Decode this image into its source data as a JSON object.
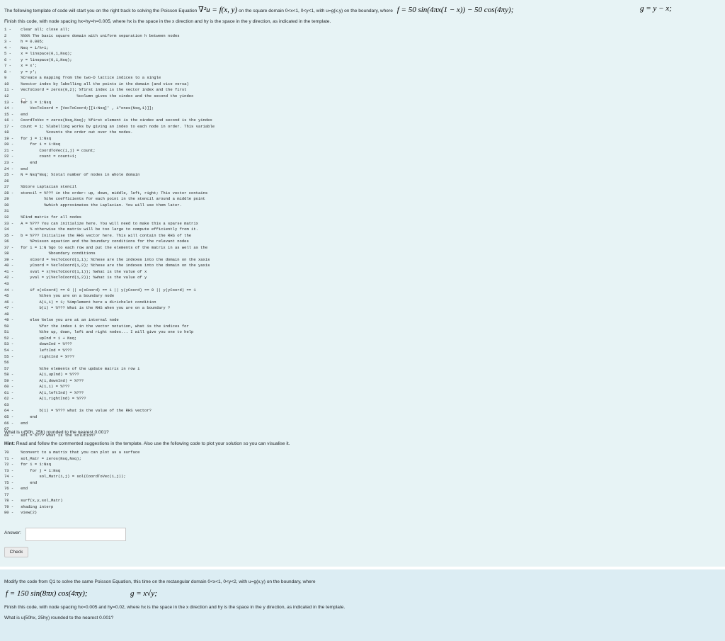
{
  "question1": {
    "intro_before": "The following template of code will start you on the right track to solving the Poisson Equation",
    "intro_eq": "∇²u = f(x, y)",
    "intro_after": "on the square domain 0<x<1, 0<y<1, with u=g(x,y) on the boundary, where",
    "f_eq": "f = 50 sin(4πx(1 − x)) − 50 cos(4πy);",
    "g_eq": "g = y − x;",
    "finish_text": "Finish this code, with node spacing hx=hy=h=0.005, where hx is the space in the x direction and hy is the space in the y direction, as indicated in the template.",
    "code_lines": [
      "1 -    clear all; close all;",
      "2      %%%% The basic square domain with uniform separation h between nodes",
      "3 -    h = 0.005;",
      "4 -    Nsq = 1/h+1;",
      "5 -    x = linspace(0,1,Nsq);",
      "6 -    y = linspace(0,1,Nsq);",
      "7 -    x = x';",
      "8 -    y = y';",
      "9      %Create a mapping from the two-D lattice indices to a single",
      "10     %vector index by labelling all the points in the domain (and vice versa)",
      "11 -   VecToCoord = zeros(0,2); %first index is the vector index and the first",
      "12                             %column gives the xindex and the second the yindex",
      "13 -   for i = 1:Nsq",
      "14 -       VecToCoord = [VecToCoord;[[1:Nsq]' , i*ones(Nsq,1)]];",
      "15 -   end",
      "16 -   CoordToVec = zeros(Nsq,Nsq); %first element is the xindex and second is the yindex",
      "17 -   count = 1; %labelling works by giving an index to each node in order. This variable",
      "18                %counts the order out over the nodes.",
      "19 -   for j = 1:Nsq",
      "20 -       for i = 1:Nsq",
      "21 -           CoordToVec(i,j) = count;",
      "22 -           count = count+1;",
      "23 -       end",
      "24 -   end",
      "25 -   N = Nsq*Nsq; %total number of nodes in whole domain",
      "26",
      "27     %Store Laplacian stencil",
      "28 -   stencil = %??? in the order: up, down, middle, left, right; This vector contains",
      "29               %the coefficients for each point in the stencil around a middle point",
      "30               %which approximates the Laplacian. You will use them later.",
      "31",
      "32     %Find matrix for all nodes",
      "33 -   A = %??? You can initialize here. You will need to make this a sparse matrix",
      "34         % otherwise the matrix will be too large to compute efficiently from it.",
      "35 -   b = %??? Initialise the RHS vector here. This will contain the RHS of the",
      "36         %Poisson equation and the boundary conditions for the relevant nodes",
      "37 -   for i = 1:N %go to each row and put the elements of the matrix in as well as the",
      "38                 %boundary conditions",
      "39 -       xCoord = VecToCoord(i,1); %these are the indexes into the domain on the xaxis",
      "40 -       yCoord = VecToCoord(i,2); %these are the indexes into the domain on the yaxis",
      "41 -       xval = x(VecToCoord(i,1)); %what is the value of x",
      "42 -       yval = y(VecToCoord(i,2)); %what is the value of y",
      "43",
      "44 -       if x(xCoord) == 0 || x(xCoord) == 1 || y(yCoord) == 0 || y(yCoord) == 1",
      "45             %then you are on a boundary node",
      "46 -           A(i,i) = 1; %implement here a dirichelet condition",
      "47 -           b(i) = %??? What is the RHS when you are on a boundary ?",
      "48",
      "49 -       else %else you are at an internal node",
      "50             %for the index i in the vector notation, what is the indices for",
      "51             %the up, down, left and right nodes... I will give you one to help",
      "52 -           upInd = i + Nsq;",
      "53 -           downInd = %???",
      "54 -           leftInd = %???",
      "55 -           rightInd = %???",
      "56",
      "57             %the elements of the update matrix in row i",
      "58 -           A(i,upInd) = %???",
      "59 -           A(i,downInd) = %???",
      "60 -           A(i,i) = %???",
      "61 -           A(i,leftInd) = %???",
      "62 -           A(i,rightInd) = %???",
      "63",
      "64 -           b(i) = %??? what is the value of the RHS vector?",
      "65 -       end",
      "66 -   end",
      "67",
      "68 -   sol = %??? What is the solution?"
    ],
    "question_text": "What is u(50h, 25h) rounded to the nearest 0.001?",
    "hint_label": "Hint:",
    "hint_text": "Read and follow the commented suggestions in the template. Also use the following code to plot your solution so you can visualise it.",
    "plot_code_lines": [
      "70     %convert to a matrix that you can plot as a surface",
      "71 -   sol_Matr = zeros(Nsq,Nsq);",
      "72 -   for i = 1:Nsq",
      "73 -       for j = 1:Nsq",
      "74 -           sol_Matr(i,j) = sol(CoordToVec(i,j));",
      "75 -       end",
      "76 -   end",
      "77",
      "78 -   surf(x,y,sol_Matr)",
      "79 -   shading interp",
      "80 -   view(2)"
    ],
    "answer_label": "Answer:",
    "answer_value": "",
    "check_label": "Check"
  },
  "question2": {
    "intro": "Modify the code from Q1 to solve the same Poisson Equation, this time on the rectangular domain 0<x<1, 0<y<2, with u=g(x,y) on the boundary, where",
    "f_eq": "f = 150 sin(8πx) cos(4πy);",
    "g_eq": "g = x√y;",
    "finish_text": "Finish this code, with node spacing hx=0.005 and hy=0.02, where hx is the space in the x direction and hy is the space in the y direction, as indicated in the template.",
    "question_text": "What is u(50hx, 25hy) rounded to the nearest 0.001?"
  }
}
